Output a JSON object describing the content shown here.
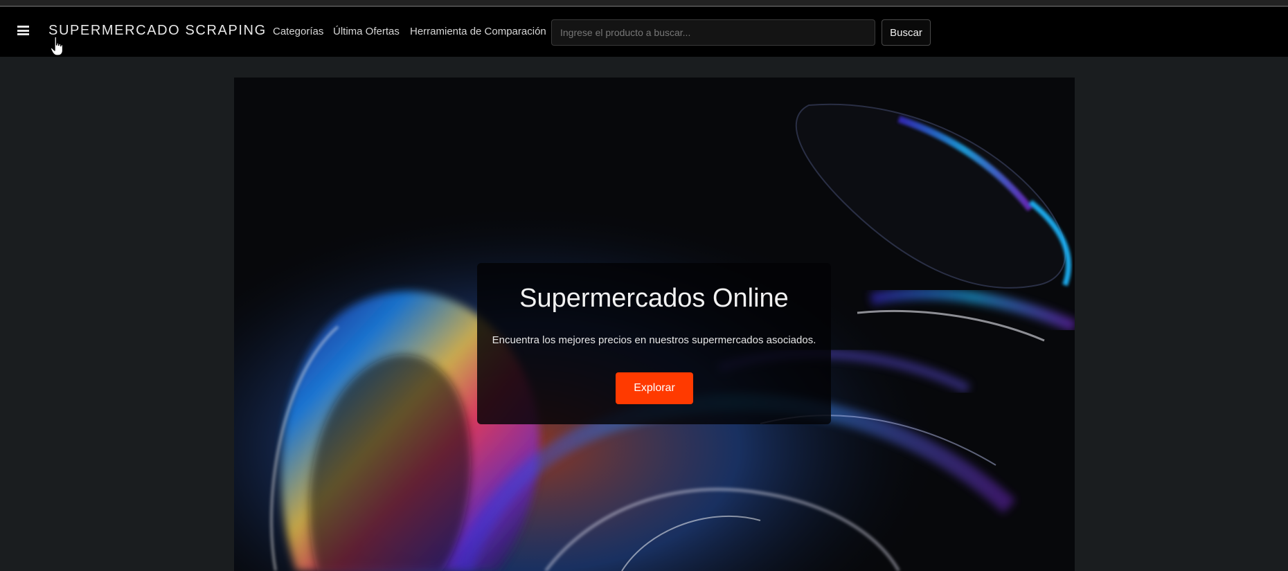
{
  "navbar": {
    "menu_icon": "hamburger-menu-icon",
    "brand": "SUPERMERCADO SCRAPING",
    "links": [
      "Categorías",
      "Última Ofertas",
      "Herramienta de Comparación"
    ],
    "search": {
      "placeholder": "Ingrese el producto a buscar...",
      "value": "",
      "button_label": "Buscar"
    }
  },
  "hero": {
    "title": "Supermercados Online",
    "subtitle": "Encuentra los mejores precios en nuestros supermercados asociados.",
    "button_label": "Explorar"
  },
  "colors": {
    "page_background": "#1a1d1f",
    "navbar_background": "#000000",
    "accent": "#ff3a00"
  },
  "cursor": "hand-pointer-icon"
}
